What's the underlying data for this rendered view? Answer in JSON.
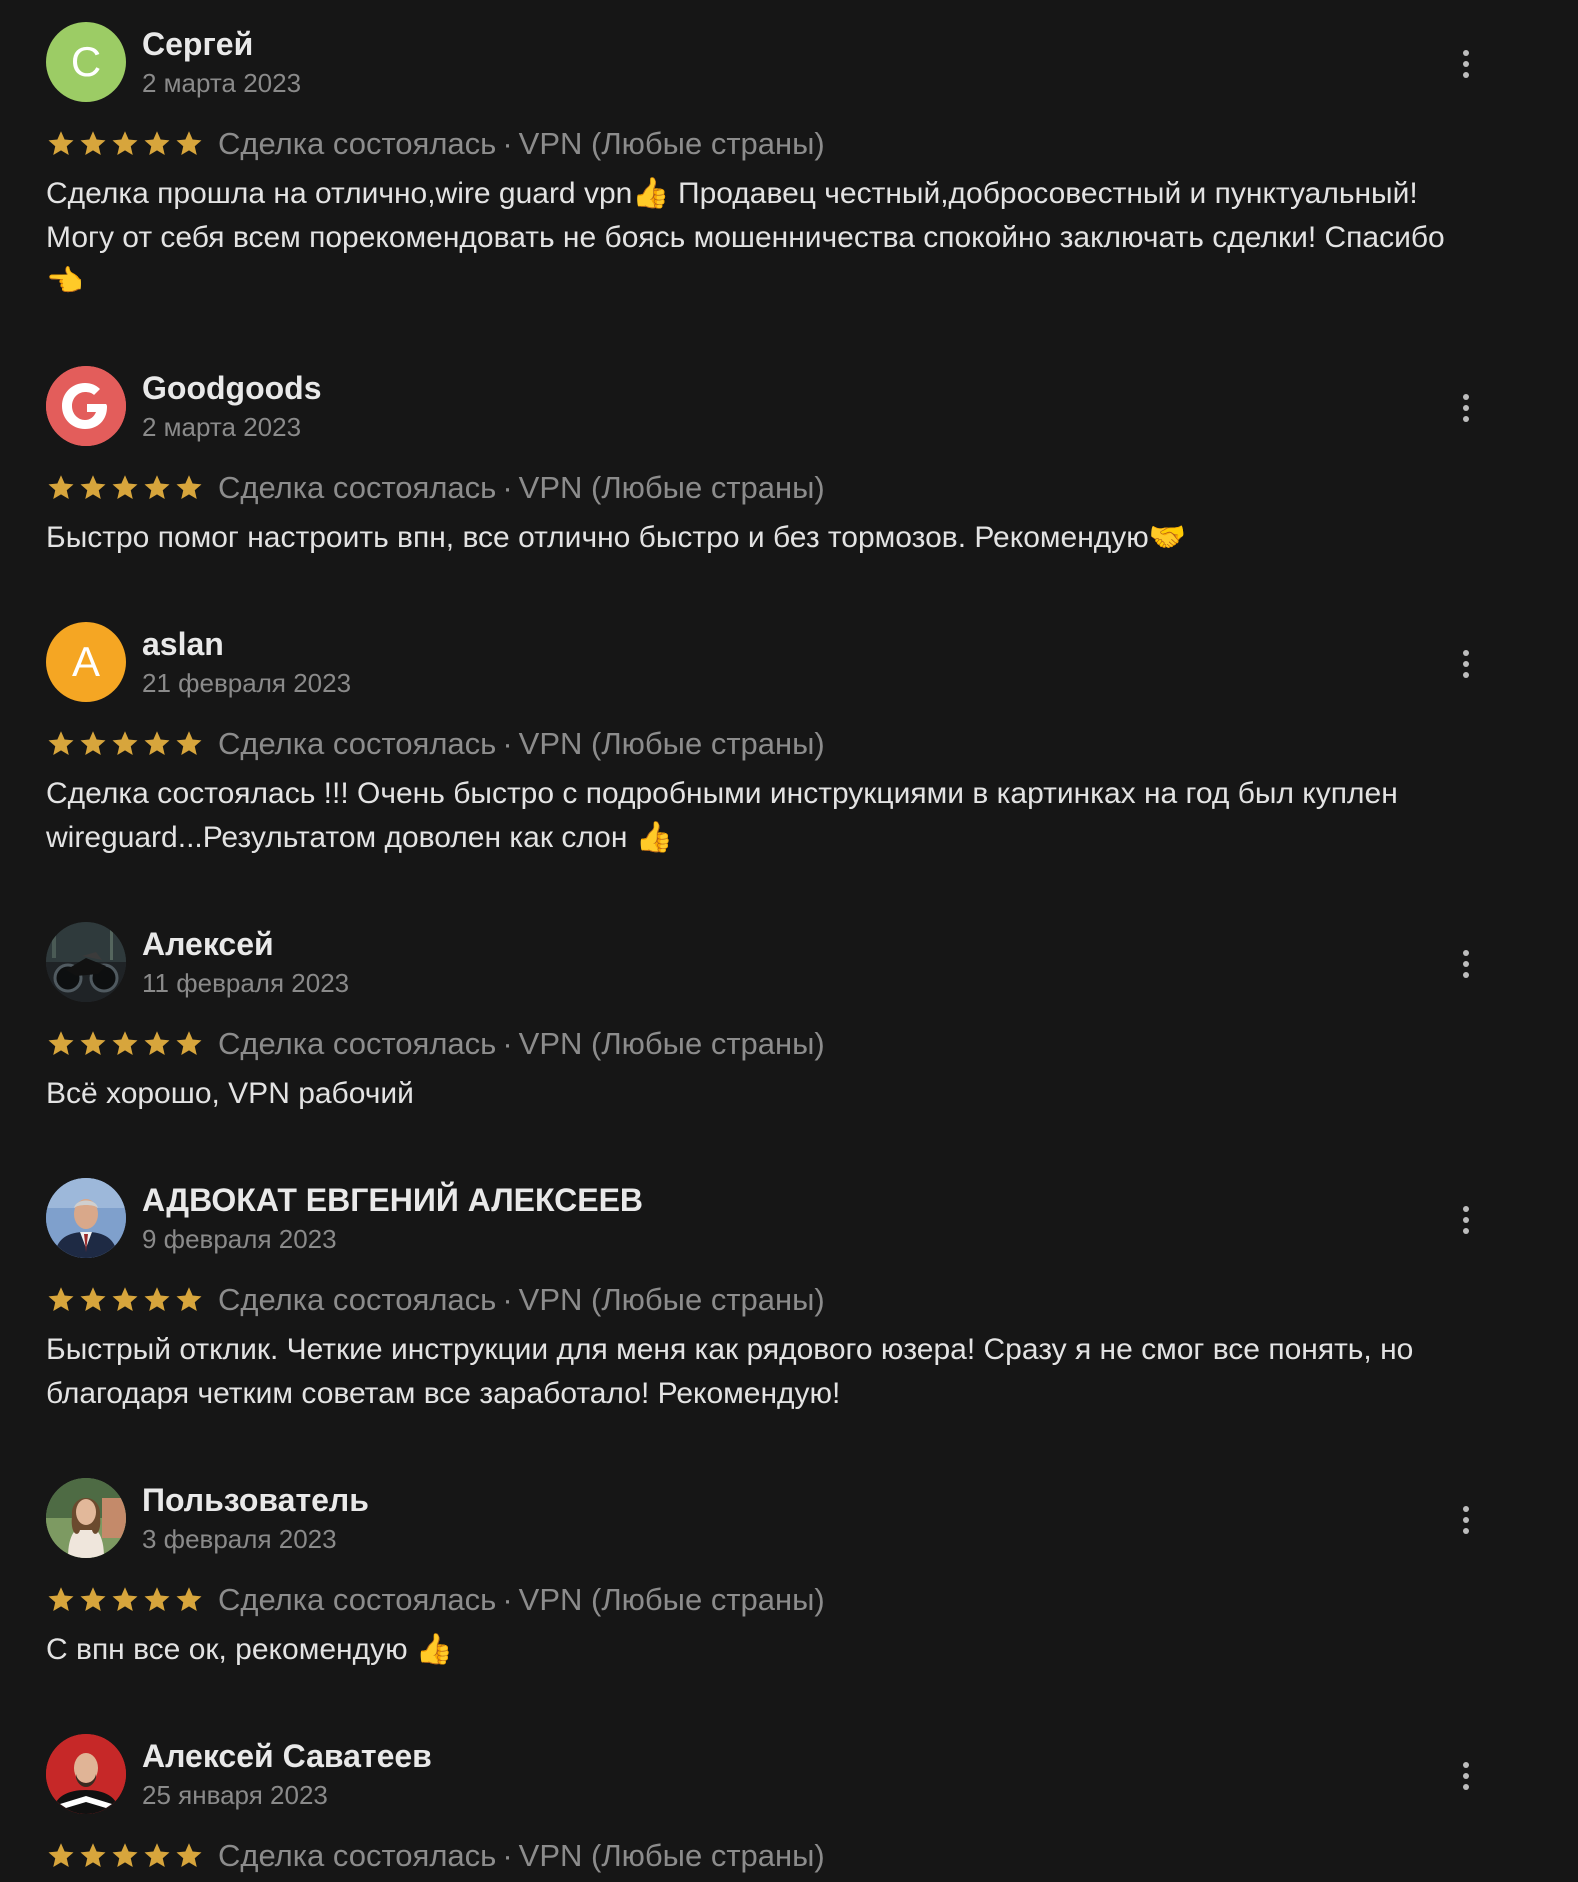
{
  "theme": {
    "background": "#161616",
    "star_color": "#d7a53c"
  },
  "reviews": [
    {
      "author": "Сергей",
      "date": "2 марта 2023",
      "rating": 5,
      "status": "Сделка состоялась",
      "separator": "·",
      "category": "VPN (Любые страны)",
      "text": "Сделка прошла на отлично,wire guard vpn👍 Продавец честный,добросовестный и пунктуальный! Могу от себя всем порекомендовать не боясь мошенничества спокойно заключать сделки! Спасибо 👈",
      "avatar": {
        "type": "letter",
        "letter": "C",
        "color": "#9ccc65"
      }
    },
    {
      "author": "Goodgoods",
      "date": "2 марта 2023",
      "rating": 5,
      "status": "Сделка состоялась",
      "separator": "·",
      "category": "VPN (Любые страны)",
      "text": "Быстро помог настроить впн, все отлично быстро и без тормозов. Рекомендую🤝",
      "avatar": {
        "type": "logo",
        "icon": "google-g-logo",
        "color": "#e35d5b"
      }
    },
    {
      "author": "aslan",
      "date": "21 февраля 2023",
      "rating": 5,
      "status": "Сделка состоялась",
      "separator": "·",
      "category": "VPN (Любые страны)",
      "text": "Сделка состоялась !!! Очень быстро с подробными инструкциями в картинках на год был куплен wireguard...Результатом доволен как слон 👍",
      "avatar": {
        "type": "letter",
        "letter": "A",
        "color": "#f5a623"
      }
    },
    {
      "author": "Алексей",
      "date": "11 февраля 2023",
      "rating": 5,
      "status": "Сделка состоялась",
      "separator": "·",
      "category": "VPN (Любые страны)",
      "text": "Всё хорошо, VPN рабочий",
      "avatar": {
        "type": "photo",
        "icon": "motorcycle-photo",
        "color": "#2c2f33"
      }
    },
    {
      "author": "АДВОКАТ ЕВГЕНИЙ АЛЕКСЕЕВ",
      "date": "9 февраля 2023",
      "rating": 5,
      "status": "Сделка состоялась",
      "separator": "·",
      "category": "VPN (Любые страны)",
      "text": "Быстрый отклик. Четкие инструкции для меня как рядового юзера! Сразу я не смог все понять, но благодаря четким советам все заработало! Рекомендую!",
      "avatar": {
        "type": "photo",
        "icon": "man-in-suit-photo",
        "color": "#5b7fb0"
      }
    },
    {
      "author": "Пользователь",
      "date": "3 февраля 2023",
      "rating": 5,
      "status": "Сделка состоялась",
      "separator": "·",
      "category": "VPN (Любые страны)",
      "text": "С впн все ок, рекомендую 👍",
      "avatar": {
        "type": "photo",
        "icon": "woman-photo",
        "color": "#6a8a5a"
      }
    },
    {
      "author": "Алексей Саватеев",
      "date": "25 января 2023",
      "rating": 5,
      "status": "Сделка состоялась",
      "separator": "·",
      "category": "VPN (Любые страны)",
      "text": "",
      "avatar": {
        "type": "photo",
        "icon": "man-red-background-photo",
        "color": "#c62828"
      }
    }
  ]
}
